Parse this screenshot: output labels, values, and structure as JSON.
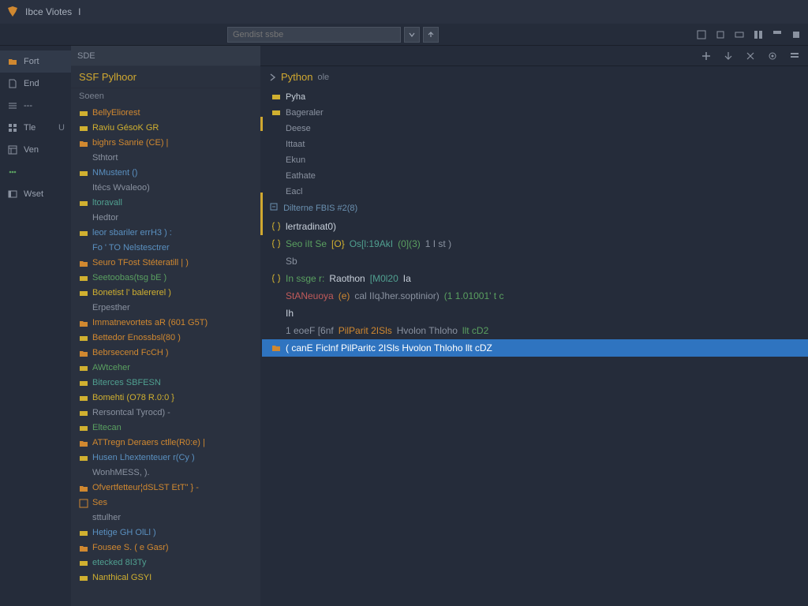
{
  "titlebar": {
    "app": "Ibce Viotes",
    "suffix": "I"
  },
  "search": {
    "placeholder": "Gendist ssbe"
  },
  "activity": {
    "items": [
      {
        "label": "Fort",
        "icon": "folder"
      },
      {
        "label": "End",
        "icon": "file"
      },
      {
        "label": "---",
        "icon": "list"
      },
      {
        "label": "Tle",
        "icon": "grid",
        "extra": "U"
      },
      {
        "label": "Ven",
        "icon": "layout"
      },
      {
        "label": "",
        "icon": "dots"
      },
      {
        "label": "Wset",
        "icon": "panel"
      }
    ]
  },
  "explorer": {
    "header": "SDE",
    "title": "SSF Pylhoor",
    "sub": "Soeen",
    "tree": [
      {
        "icon": "struct",
        "color": "c-orange",
        "text": "BellyEliorest"
      },
      {
        "icon": "struct",
        "color": "c-yellow",
        "text": "Raviu GésoK GR"
      },
      {
        "icon": "folder",
        "color": "c-orange",
        "text": "bighrs Sanrie (CE) |"
      },
      {
        "icon": "none",
        "color": "c-gray",
        "text": "Sthtort"
      },
      {
        "icon": "struct",
        "color": "c-blue",
        "text": "NMustent ()"
      },
      {
        "icon": "none",
        "color": "c-gray",
        "text": "Itécs Wvaleoo)"
      },
      {
        "icon": "struct",
        "color": "c-teal",
        "text": "ltoravall"
      },
      {
        "icon": "none",
        "color": "c-gray",
        "text": "Hedtor"
      },
      {
        "icon": "struct",
        "color": "c-blue",
        "text": "leor sbariler errH3 ) :"
      },
      {
        "icon": "none",
        "color": "c-blue",
        "text": "Fo ' TO Nelstesctrer"
      },
      {
        "icon": "folder",
        "color": "c-orange",
        "text": "Seuro TFost Stéteratill | )"
      },
      {
        "icon": "struct",
        "color": "c-green",
        "text": "Seetoobas(tsg bE )",
        "extra_color": "c-green"
      },
      {
        "icon": "struct",
        "color": "c-yellow",
        "text": "Bonetist l' balererel )"
      },
      {
        "icon": "none",
        "color": "c-gray",
        "text": "Erpesther"
      },
      {
        "icon": "folder",
        "color": "c-orange",
        "text": "Immatnevortets aR (601 G5T)"
      },
      {
        "icon": "struct",
        "color": "c-orange",
        "text": "Bettedor Enossbsl(80 )"
      },
      {
        "icon": "folder",
        "color": "c-orange",
        "text": "Bebrsecend FcCH )"
      },
      {
        "icon": "struct",
        "color": "c-green",
        "text": "AWtceher"
      },
      {
        "icon": "struct",
        "color": "c-teal",
        "text": "Biterces SBFESN"
      },
      {
        "icon": "struct",
        "color": "c-yellow",
        "text": "Bomehti (O78 R.0:0 }"
      },
      {
        "icon": "struct",
        "color": "c-gray",
        "text": "Rersontcal Tyrocd) -"
      },
      {
        "icon": "struct",
        "color": "c-green",
        "text": "Eltecan"
      },
      {
        "icon": "folder",
        "color": "c-orange",
        "text": "ATTregn Deraers ctlle(R0:e) |",
        "mix_green": true
      },
      {
        "icon": "struct",
        "color": "c-blue",
        "text": "Husen Lhextenteuer r(Cy )"
      },
      {
        "icon": "none",
        "color": "c-gray",
        "text": "WonhMESS, )."
      },
      {
        "icon": "folder",
        "color": "c-orange",
        "text": "Ofvertfetteur¦dSLST EtT\" } -"
      },
      {
        "icon": "box",
        "color": "c-orange",
        "text": "Ses"
      },
      {
        "icon": "none",
        "color": "c-gray",
        "text": "sttulher"
      },
      {
        "icon": "struct",
        "color": "c-blue",
        "text": "Hetige GH OlLl )"
      },
      {
        "icon": "folder",
        "color": "c-orange",
        "text": "Fousee S. ( e Gasr)"
      },
      {
        "icon": "struct",
        "color": "c-teal",
        "text": "etecked 8I3Ty"
      },
      {
        "icon": "struct",
        "color": "c-yellow",
        "text": "Nanthical GSYI"
      }
    ]
  },
  "editor": {
    "tab_label": "Python",
    "tab_sub": "ole",
    "outline": [
      {
        "text": "Pyha"
      },
      {
        "text": "Bageraler"
      },
      {
        "text": "Deese"
      },
      {
        "text": "Ittaat"
      },
      {
        "text": "Ekun"
      },
      {
        "text": "Eathate"
      },
      {
        "text": "Eacl"
      }
    ],
    "section": "Dilterne FBIS #2(8)",
    "code": [
      {
        "icon": "brace",
        "color": "c-orange",
        "segments": [
          {
            "t": "lertradinat0)",
            "c": "c-white"
          }
        ]
      },
      {
        "icon": "brace",
        "color": "c-yellow",
        "segments": [
          {
            "t": "Seo iIt Se",
            "c": "c-green"
          },
          {
            "t": " [O}",
            "c": "c-yellow"
          },
          {
            "t": "Os[l:19AkI",
            "c": "c-teal"
          },
          {
            "t": "(0](3)",
            "c": "c-green"
          },
          {
            "t": " 1 I st )",
            "c": "c-gray"
          }
        ]
      },
      {
        "icon": "none",
        "color": "c-gray",
        "segments": [
          {
            "t": "Sb",
            "c": "c-gray"
          }
        ]
      },
      {
        "icon": "brace",
        "color": "c-green",
        "segments": [
          {
            "t": "In ssge r:",
            "c": "c-green"
          },
          {
            "t": "Raothon",
            "c": "c-white"
          },
          {
            "t": "[M0l20",
            "c": "c-teal"
          },
          {
            "t": "Ia",
            "c": "c-white"
          }
        ]
      },
      {
        "icon": "none",
        "color": "c-gray",
        "segments": [
          {
            "t": "StANeuoya",
            "c": "c-red"
          },
          {
            "t": "(e)",
            "c": "c-orange"
          },
          {
            "t": " cal IIqJher.soptinior) ",
            "c": "c-gray"
          },
          {
            "t": "(1 1.01001' t c",
            "c": "c-green"
          }
        ]
      },
      {
        "icon": "none",
        "color": "c-gray",
        "segments": [
          {
            "t": "Ih",
            "c": "c-white"
          }
        ]
      },
      {
        "icon": "none",
        "color": "c-gray",
        "segments": [
          {
            "t": "1 eoeF [6nf ",
            "c": "c-gray"
          },
          {
            "t": "PilParit 2ISls",
            "c": "c-orange"
          },
          {
            "t": " Hvolon Thloho ",
            "c": "c-gray"
          },
          {
            "t": "llt cD2",
            "c": "c-green"
          }
        ]
      },
      {
        "icon": "folder",
        "color": "c-blue",
        "selected": true,
        "segments": [
          {
            "t": "( canE Ficlnf PilParitc 2ISls Hvolon Thloho llt cDZ",
            "c": ""
          }
        ]
      }
    ]
  }
}
